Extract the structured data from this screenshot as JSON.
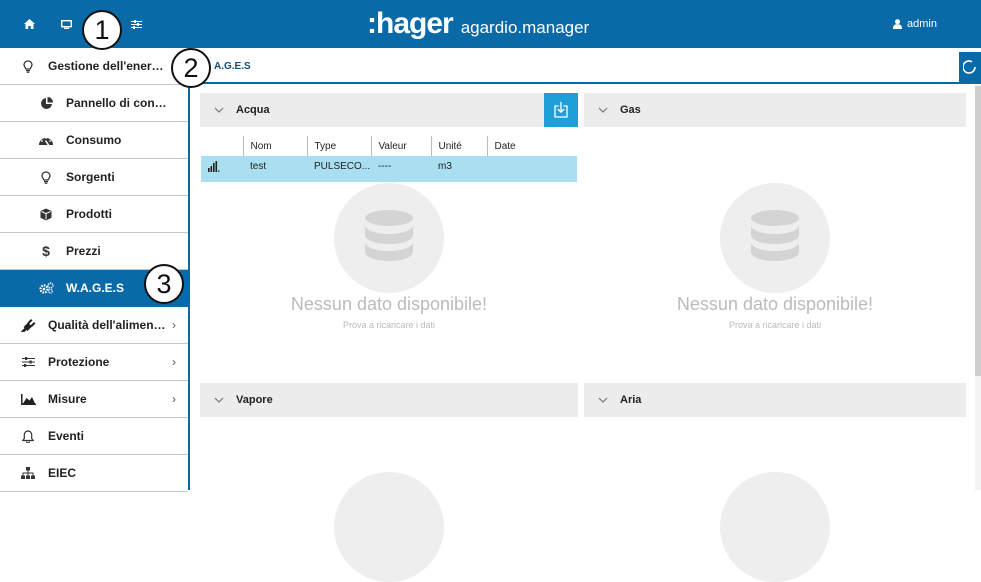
{
  "topbar": {
    "home_icon": "home-icon",
    "monitor_icon": "monitor-icon",
    "settings_icon": "sliders-icon",
    "brand": ":hager",
    "product": "agardio.manager",
    "user": "admin",
    "color": "#0a6aa8"
  },
  "sidebar": {
    "items": [
      {
        "label": "Gestione dell'ener…",
        "icon": "lightbulb-icon"
      },
      {
        "label": "Pannello di con…",
        "icon": "pie-chart-icon"
      },
      {
        "label": "Consumo",
        "icon": "gauge-icon"
      },
      {
        "label": "Sorgenti",
        "icon": "lightbulb-icon"
      },
      {
        "label": "Prodotti",
        "icon": "cube-icon"
      },
      {
        "label": "Prezzi",
        "icon": "dollar-icon"
      },
      {
        "label": "W.A.G.E.S",
        "icon": "cogs-icon"
      },
      {
        "label": "Qualità dell'alimen…",
        "icon": "plug-icon"
      },
      {
        "label": "Protezione",
        "icon": "sliders-icon"
      },
      {
        "label": "Misure",
        "icon": "area-chart-icon"
      },
      {
        "label": "Eventi",
        "icon": "bell-icon"
      },
      {
        "label": "EIEC",
        "icon": "sitemap-icon"
      }
    ],
    "chevron": "›"
  },
  "breadcrumb": {
    "text": "A.G.E.S"
  },
  "callouts": [
    "1",
    "2",
    "3"
  ],
  "panels": {
    "acqua": {
      "title": "Acqua"
    },
    "gas": {
      "title": "Gas"
    },
    "vapore": {
      "title": "Vapore"
    },
    "aria": {
      "title": "Aria"
    }
  },
  "table": {
    "columns": [
      "",
      "Nom",
      "Type",
      "Valeur",
      "Unité",
      "Date"
    ],
    "rows": [
      {
        "icon": "signal-icon",
        "nom": "test",
        "type": "PULSECO...",
        "valeur": "----",
        "unite": "m3",
        "date": ""
      }
    ]
  },
  "empty": {
    "title": "Nessun dato disponibile!",
    "subtitle": "Prova a ricaricare i dati"
  }
}
